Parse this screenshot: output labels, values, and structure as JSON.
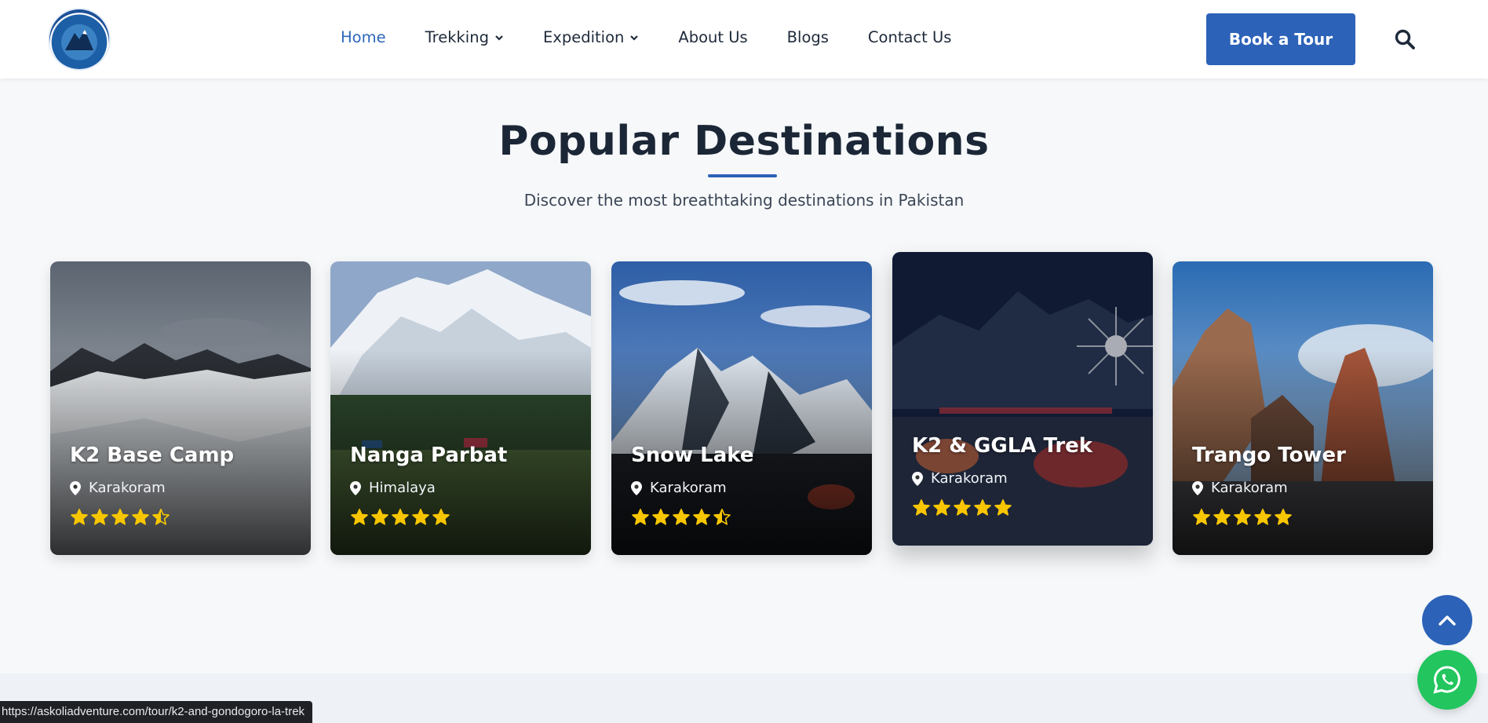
{
  "header": {
    "logo_alt": "Askoli Adventure Treks & Tours",
    "nav": [
      {
        "label": "Home",
        "active": true,
        "dropdown": false
      },
      {
        "label": "Trekking",
        "active": false,
        "dropdown": true
      },
      {
        "label": "Expedition",
        "active": false,
        "dropdown": true
      },
      {
        "label": "About Us",
        "active": false,
        "dropdown": false
      },
      {
        "label": "Blogs",
        "active": false,
        "dropdown": false
      },
      {
        "label": "Contact Us",
        "active": false,
        "dropdown": false
      }
    ],
    "cta_label": "Book a Tour",
    "search_icon": "search-icon"
  },
  "section": {
    "title": "Popular Destinations",
    "subtitle": "Discover the most breathtaking destinations in Pakistan"
  },
  "destinations": [
    {
      "name": "K2 Base Camp",
      "location": "Karakoram",
      "rating": 4.5
    },
    {
      "name": "Nanga Parbat",
      "location": "Himalaya",
      "rating": 5
    },
    {
      "name": "Snow Lake",
      "location": "Karakoram",
      "rating": 4.5
    },
    {
      "name": "K2 & GGLA Trek",
      "location": "Karakoram",
      "rating": 5
    },
    {
      "name": "Trango Tower",
      "location": "Karakoram",
      "rating": 5
    }
  ],
  "colors": {
    "primary": "#2c62b8",
    "star": "#f7c600",
    "whatsapp": "#22c55e"
  },
  "status_bar": {
    "url": "https://askoliadventure.com/tour/k2-and-gondogoro-la-trek"
  }
}
